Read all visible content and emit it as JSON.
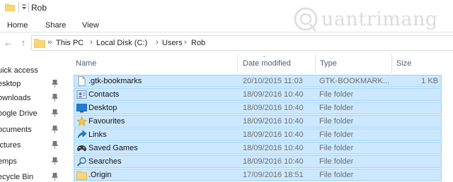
{
  "window": {
    "title": "Rob"
  },
  "ribbon": {
    "tabs": [
      "Home",
      "Share",
      "View"
    ]
  },
  "address": {
    "crumbs": [
      "This PC",
      "Local Disk (C:)",
      "Users",
      "Rob"
    ]
  },
  "watermark": {
    "text": "uantrimang"
  },
  "nav_pane": {
    "items": [
      {
        "label": "uick access",
        "pinned": false
      },
      {
        "label": "esktop",
        "pinned": true
      },
      {
        "label": "ownloads",
        "pinned": true
      },
      {
        "label": "oogle Drive",
        "pinned": true
      },
      {
        "label": "ocuments",
        "pinned": true
      },
      {
        "label": "ictures",
        "pinned": true
      },
      {
        "label": "emps",
        "pinned": true
      },
      {
        "label": "ecycle Bin",
        "pinned": true
      }
    ]
  },
  "columns": {
    "name": "Name",
    "date": "Date modified",
    "type": "Type",
    "size": "Size"
  },
  "files": [
    {
      "name": ".gtk-bookmarks",
      "date": "20/10/2015 11:03",
      "type": "GTK-BOOKMARK...",
      "size": "1 KB",
      "icon": "document-icon"
    },
    {
      "name": "Contacts",
      "date": "18/09/2016 10:40",
      "type": "File folder",
      "size": "",
      "icon": "contacts-icon"
    },
    {
      "name": "Desktop",
      "date": "18/09/2016 10:40",
      "type": "File folder",
      "size": "",
      "icon": "desktop-icon"
    },
    {
      "name": "Favourites",
      "date": "18/09/2016 10:40",
      "type": "File folder",
      "size": "",
      "icon": "star-icon"
    },
    {
      "name": "Links",
      "date": "18/09/2016 10:40",
      "type": "File folder",
      "size": "",
      "icon": "links-icon"
    },
    {
      "name": "Saved Games",
      "date": "18/09/2016 10:40",
      "type": "File folder",
      "size": "",
      "icon": "saved-games-icon"
    },
    {
      "name": "Searches",
      "date": "18/09/2016 10:40",
      "type": "File folder",
      "size": "",
      "icon": "search-icon"
    },
    {
      "name": ".Origin",
      "date": "17/09/2016 18:51",
      "type": "File folder",
      "size": "",
      "icon": "folder-icon"
    }
  ],
  "colors": {
    "selection_fill": "#cce8ff",
    "selection_border": "#99d1ff",
    "header_text": "#4c607a",
    "folder_yellow": "#f8d775"
  }
}
